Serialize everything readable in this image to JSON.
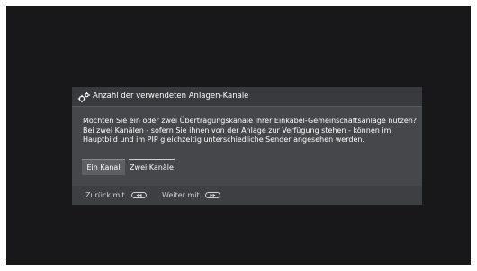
{
  "dialog": {
    "title": "Anzahl der verwendeten Anlagen-Kanäle",
    "title_icon": "gear-icon",
    "message_lines": [
      "Möchten Sie ein oder zwei Übertragungskanäle Ihrer Einkabel-Gemeinschaftsanlage nutzen?",
      "Bei zwei Kanälen - sofern Sie ihnen von der Anlage zur Verfügung stehen - können im",
      "Hauptbild und im PIP gleichzeitig unterschiedliche Sender angesehen werden."
    ],
    "options": [
      "Ein Kanal",
      "Zwei Kanäle"
    ],
    "selected_option": "Ein Kanal"
  },
  "footer": {
    "back_label": "Zurück mit",
    "back_icon": "rewind-button-icon",
    "next_label": "Weiter mit",
    "next_icon": "fast-forward-button-icon"
  },
  "colors": {
    "screen_bg": "#18181a",
    "dialog_bg": "#46474b",
    "selected_bg": "#5d5f64"
  }
}
